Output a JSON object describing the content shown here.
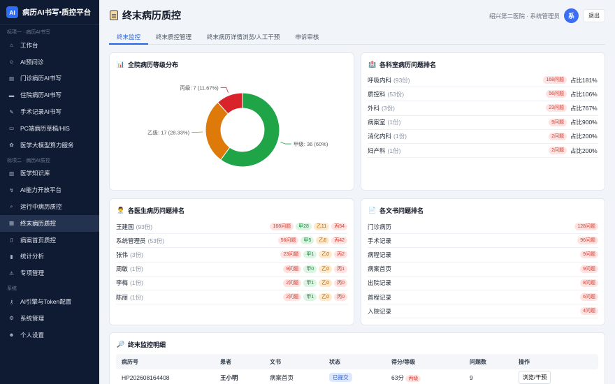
{
  "brand": {
    "logo": "AI",
    "title": "病历AI书写•质控平台"
  },
  "sidebar": {
    "sections": [
      {
        "title": "标项一 · 病历AI书写"
      },
      {
        "title": "标项二 · 病历AI质控"
      },
      {
        "title": "系统"
      }
    ],
    "items": [
      {
        "label": "工作台",
        "icon": "home-icon"
      },
      {
        "label": "AI预问诊",
        "icon": "doctor-icon"
      },
      {
        "label": "门诊病历AI书写",
        "icon": "notes-icon"
      },
      {
        "label": "住院病历AI书写",
        "icon": "bed-icon"
      },
      {
        "label": "手术记录AI书写",
        "icon": "scalpel-icon"
      },
      {
        "label": "PC端病历草稿/HIS",
        "icon": "monitor-icon"
      },
      {
        "label": "医学大模型算力服务",
        "icon": "brain-icon"
      },
      {
        "label": "医学知识库",
        "icon": "book-icon"
      },
      {
        "label": "AI能力开放平台",
        "icon": "plug-icon"
      },
      {
        "label": "运行中病历质控",
        "icon": "search-icon"
      },
      {
        "label": "终末病历质控",
        "icon": "clipboard-icon"
      },
      {
        "label": "病案首页质控",
        "icon": "page-icon"
      },
      {
        "label": "统计分析",
        "icon": "chart-icon"
      },
      {
        "label": "专项管理",
        "icon": "warning-icon"
      },
      {
        "label": "AI引擎与Token配置",
        "icon": "key-icon"
      },
      {
        "label": "系统管理",
        "icon": "gear-icon"
      },
      {
        "label": "个人设置",
        "icon": "user-icon"
      }
    ]
  },
  "header": {
    "title": "终末病历质控",
    "hospital": "绍兴第二医院 · 系统管理员",
    "avatar": "系",
    "logout": "退出"
  },
  "tabs": [
    "终末监控",
    "终末质控管理",
    "终末病历详情浏览/人工干预",
    "申诉审核"
  ],
  "grade_card": {
    "title": "全院病历等级分布",
    "labels": [
      "甲级: 36 (60%)",
      "乙级: 17 (28.33%)",
      "丙级: 7 (11.67%)"
    ]
  },
  "chart_data": {
    "type": "pie",
    "variant": "donut",
    "categories": [
      "甲级",
      "乙级",
      "丙级"
    ],
    "values": [
      36,
      17,
      7
    ],
    "percentages": [
      60,
      28.33,
      11.67
    ],
    "colors": [
      "#1fa447",
      "#de7a0a",
      "#d8232a"
    ]
  },
  "dept_card": {
    "title": "各科室病历问题排名",
    "rows": [
      {
        "name": "呼吸内科",
        "count": "(93份)",
        "issues": "168问题",
        "ratio": "占比181%"
      },
      {
        "name": "质控科",
        "count": "(53份)",
        "issues": "56问题",
        "ratio": "占比106%"
      },
      {
        "name": "外科",
        "count": "(3份)",
        "issues": "23问题",
        "ratio": "占比767%"
      },
      {
        "name": "病案室",
        "count": "(1份)",
        "issues": "9问题",
        "ratio": "占比900%"
      },
      {
        "name": "消化内科",
        "count": "(1份)",
        "issues": "2问题",
        "ratio": "占比200%"
      },
      {
        "name": "妇产科",
        "count": "(1份)",
        "issues": "2问题",
        "ratio": "占比200%"
      }
    ]
  },
  "doctor_card": {
    "title": "各医生病历问题排名",
    "rows": [
      {
        "name": "王建国",
        "count": "(93份)",
        "issues": "168问题",
        "a": "甲28",
        "b": "乙11",
        "c": "丙54"
      },
      {
        "name": "系统管理员",
        "count": "(53份)",
        "issues": "56问题",
        "a": "甲5",
        "b": "乙6",
        "c": "丙42"
      },
      {
        "name": "张伟",
        "count": "(3份)",
        "issues": "23问题",
        "a": "甲1",
        "b": "乙0",
        "c": "丙2"
      },
      {
        "name": "周敏",
        "count": "(1份)",
        "issues": "9问题",
        "a": "甲0",
        "b": "乙0",
        "c": "丙1"
      },
      {
        "name": "李梅",
        "count": "(1份)",
        "issues": "2问题",
        "a": "甲1",
        "b": "乙0",
        "c": "丙0"
      },
      {
        "name": "陈丽",
        "count": "(1份)",
        "issues": "2问题",
        "a": "甲1",
        "b": "乙0",
        "c": "丙0"
      }
    ]
  },
  "doc_card": {
    "title": "各文书问题排名",
    "rows": [
      {
        "name": "门诊病历",
        "issues": "128问题"
      },
      {
        "name": "手术记录",
        "issues": "96问题"
      },
      {
        "name": "病程记录",
        "issues": "9问题"
      },
      {
        "name": "病案首页",
        "issues": "9问题"
      },
      {
        "name": "出院记录",
        "issues": "8问题"
      },
      {
        "name": "首程记录",
        "issues": "6问题"
      },
      {
        "name": "入院记录",
        "issues": "4问题"
      }
    ]
  },
  "detail": {
    "title": "终末监控明细",
    "headers": [
      "病历号",
      "患者",
      "文书",
      "状态",
      "得分/等级",
      "问题数",
      "操作"
    ],
    "rows": [
      {
        "id": "HP202608164408",
        "patient": "王小明",
        "doc": "病案首页",
        "status": "已提交",
        "score": "63分",
        "grade": "丙级",
        "issues": "9",
        "action": "浏览/干预"
      }
    ]
  }
}
